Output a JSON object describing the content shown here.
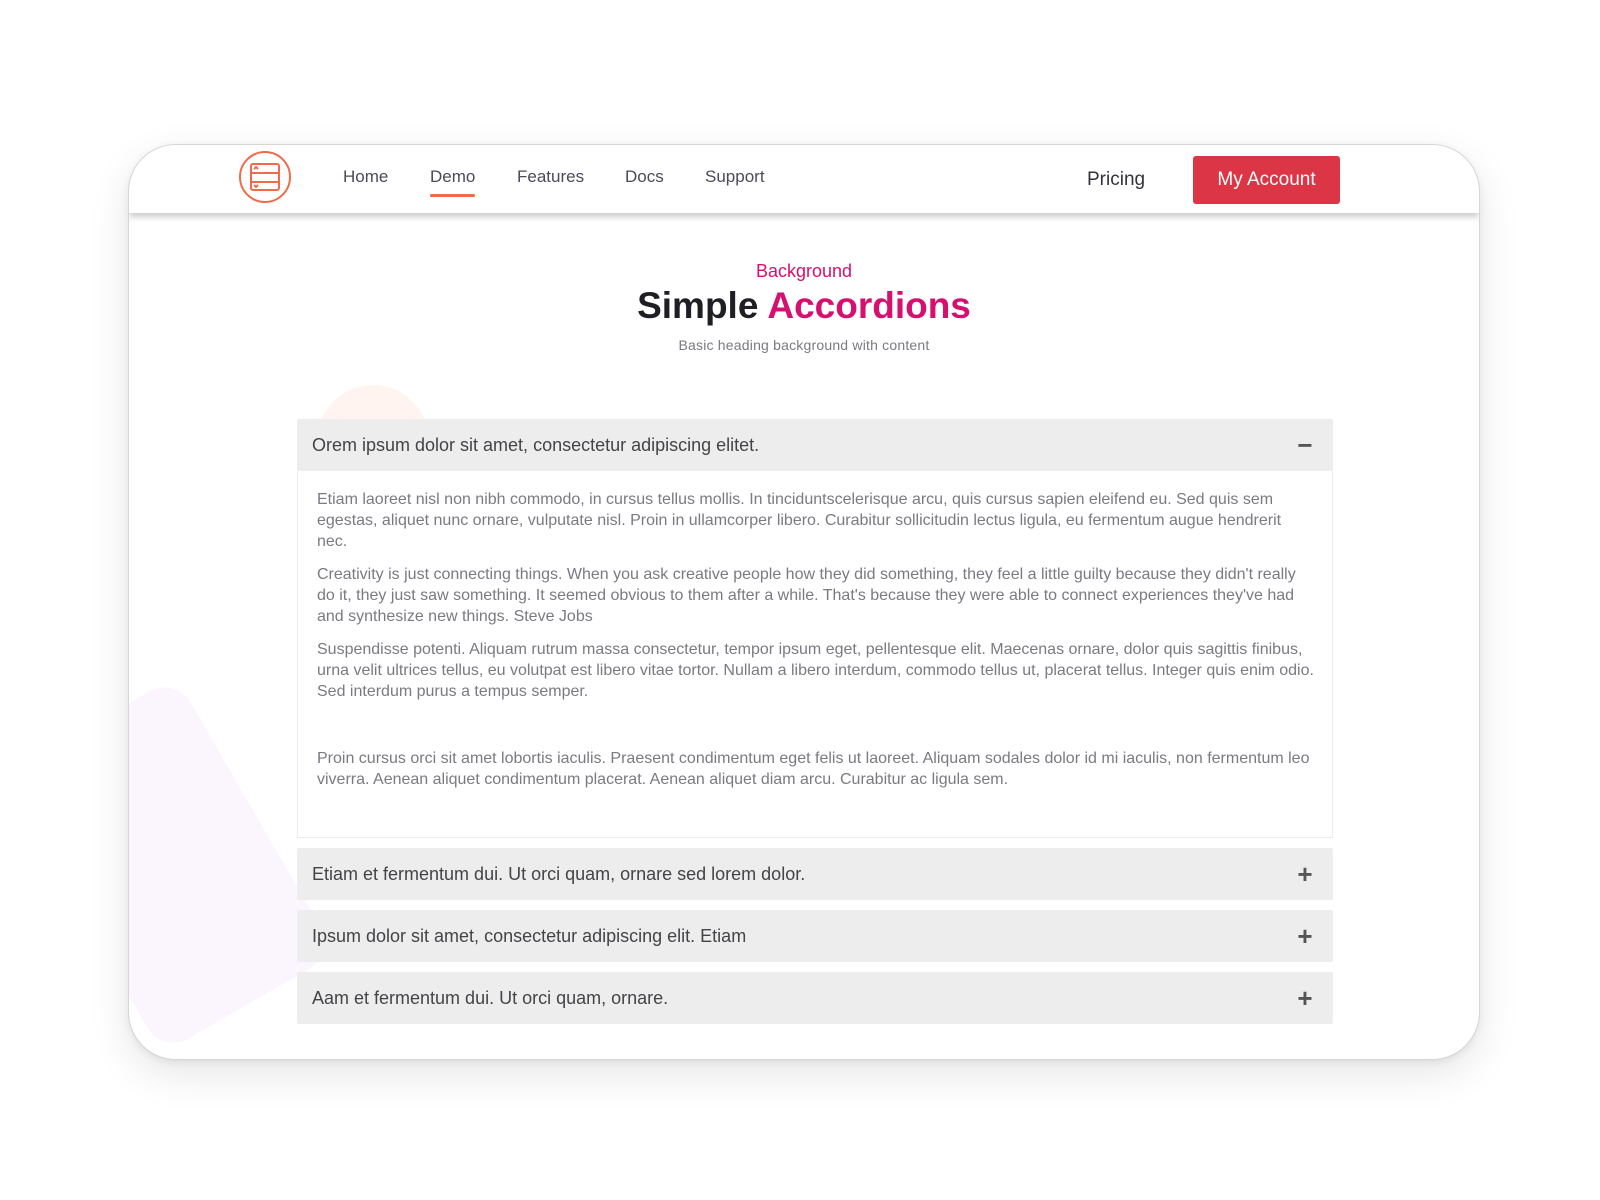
{
  "nav": {
    "links": [
      "Home",
      "Demo",
      "Features",
      "Docs",
      "Support"
    ],
    "active": "Demo",
    "pricing": "Pricing",
    "account_button": "My Account"
  },
  "header": {
    "eyebrow": "Background",
    "title_plain": "Simple",
    "title_accent": "Accordions",
    "subtitle": "Basic heading background with content"
  },
  "accordion": {
    "items": [
      {
        "title": "Orem ipsum dolor sit amet, consectetur adipiscing elitet.",
        "toggle": "−",
        "expanded": true,
        "paragraphs": [
          "Etiam laoreet nisl non nibh commodo, in cursus tellus mollis. In tinciduntscelerisque arcu, quis cursus sapien eleifend eu. Sed quis sem egestas, aliquet nunc ornare, vulputate nisl. Proin in ullamcorper libero. Curabitur sollicitudin lectus ligula, eu fermentum augue hendrerit nec.",
          "Creativity is just connecting things. When you ask creative people how they did something, they feel a little guilty because they didn't really do it, they just saw something. It seemed obvious to them after a while. That's because they were able to connect experiences they've had and synthesize new things. Steve Jobs",
          "Suspendisse potenti. Aliquam rutrum massa consectetur, tempor ipsum eget, pellentesque elit. Maecenas ornare, dolor quis sagittis finibus, urna velit ultrices tellus, eu volutpat est libero vitae tortor. Nullam a libero interdum, commodo tellus ut, placerat tellus. Integer quis enim odio. Sed interdum purus a tempus semper.",
          "Proin cursus orci sit amet lobortis iaculis. Praesent condimentum eget felis ut laoreet. Aliquam sodales dolor id mi iaculis, non fermentum leo viverra. Aenean aliquet condimentum placerat. Aenean aliquet diam arcu. Curabitur ac ligula sem."
        ]
      },
      {
        "title": "Etiam et fermentum dui. Ut orci quam, ornare sed lorem dolor.",
        "toggle": "+",
        "expanded": false
      },
      {
        "title": "Ipsum dolor sit amet, consectetur adipiscing elit. Etiam",
        "toggle": "+",
        "expanded": false
      },
      {
        "title": "Aam et fermentum dui. Ut orci quam, ornare.",
        "toggle": "+",
        "expanded": false
      }
    ]
  },
  "colors": {
    "accent": "#d6106e",
    "button": "#dc3545",
    "logo": "#f26a4b"
  },
  "icons": {
    "logo": "accordion-logo-icon"
  }
}
